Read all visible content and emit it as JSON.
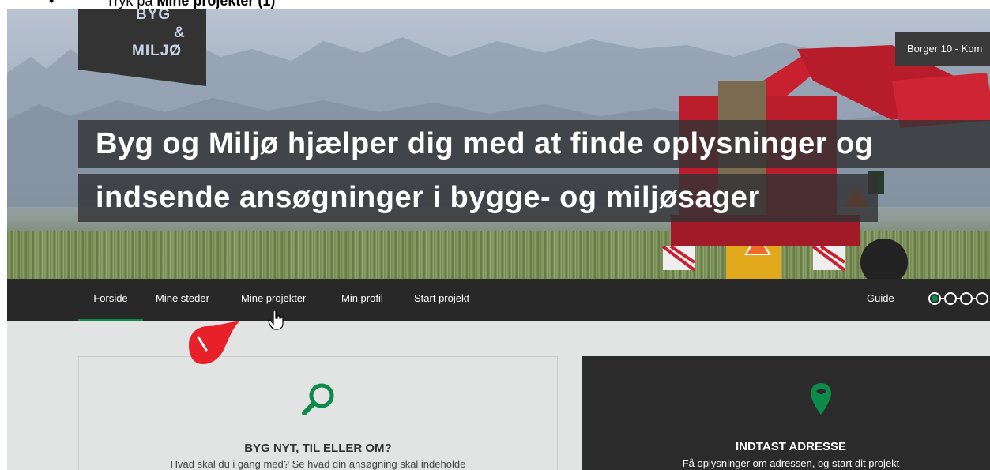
{
  "instruction": {
    "bullet": "•",
    "prefix": "Tryk på",
    "bold": "Mine projekter (1)"
  },
  "header": {
    "logo_lines": [
      "BYG",
      "&",
      "MILJØ"
    ],
    "user_label": "Borger 10 - Kom"
  },
  "hero": {
    "headline_line1": "Byg og Miljø hjælper dig med at finde oplysninger og",
    "headline_line2": "indsende ansøgninger i bygge- og miljøsager"
  },
  "nav": {
    "items": [
      {
        "label": "Forside"
      },
      {
        "label": "Mine steder"
      },
      {
        "label": "Mine projekter"
      },
      {
        "label": "Min profil"
      },
      {
        "label": "Start projekt"
      }
    ],
    "guide_label": "Guide"
  },
  "annotation": {
    "marker_number": "1",
    "marker_color": "#e8202a"
  },
  "cards": {
    "left": {
      "icon": "search-icon",
      "title": "BYG NYT, TIL ELLER OM?",
      "subtitle": "Hvad skal du i gang med? Se hvad din ansøgning skal indeholde"
    },
    "right": {
      "icon": "map-pin-icon",
      "title": "INDTAST ADRESSE",
      "subtitle": "Få oplysninger om adressen, og start dit projekt"
    }
  },
  "colors": {
    "accent_green": "#0b8a4a",
    "nav_bg": "#282828",
    "logo_text": "#c9d3e6"
  }
}
